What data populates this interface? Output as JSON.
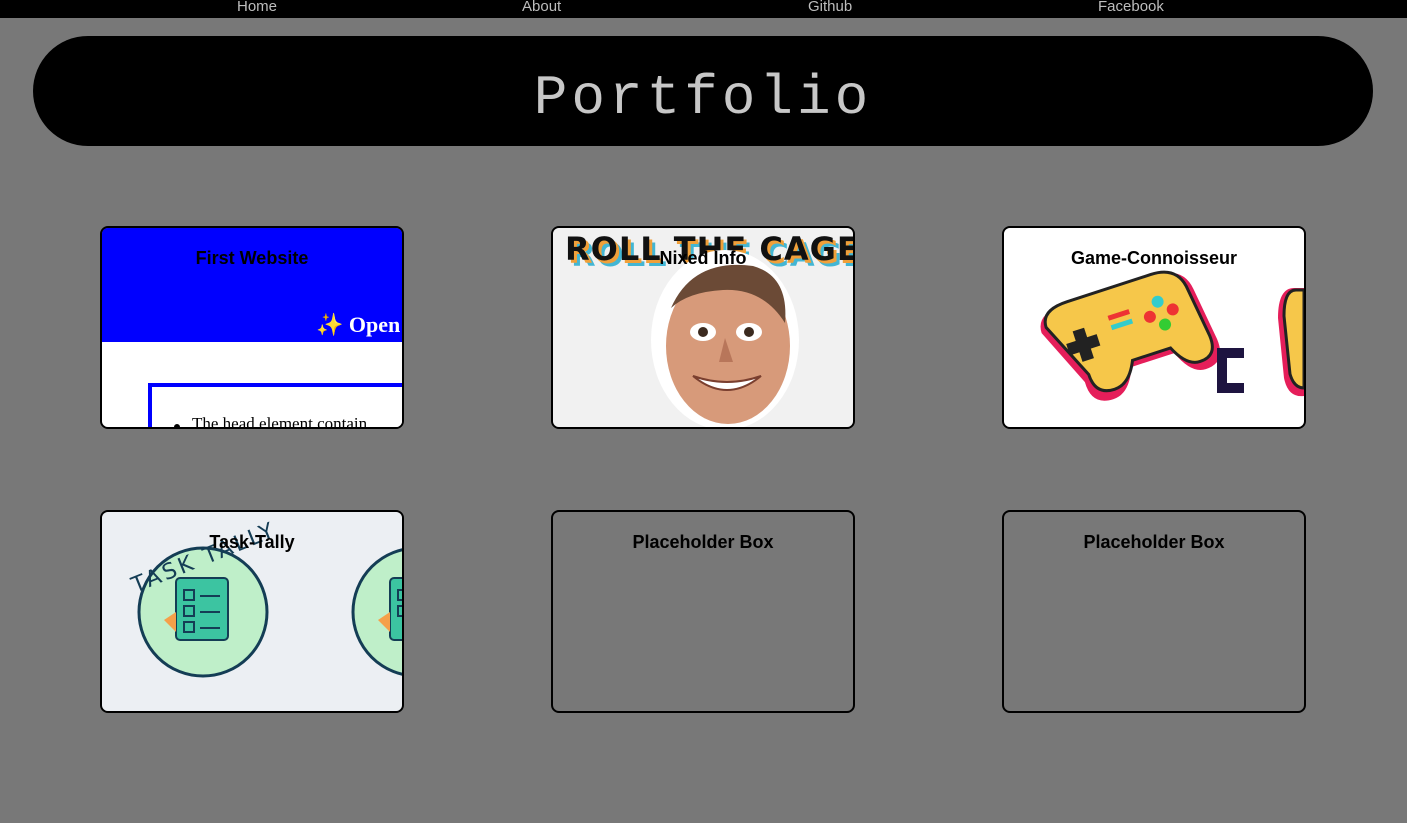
{
  "nav": {
    "home": "Home",
    "about": "About",
    "github": "Github",
    "facebook": "Facebook"
  },
  "banner": {
    "title": "Portfolio"
  },
  "cards": [
    {
      "title": "First Website",
      "preview_heading": "✨ Open",
      "preview_text": "The head element contain"
    },
    {
      "title": "Nixed Info",
      "preview_text": "ROLL THE CAGE DI"
    },
    {
      "title": "Game-Connoisseur"
    },
    {
      "title": "Task-Tally",
      "preview_text": "TASK TALLY"
    },
    {
      "title": "Placeholder Box"
    },
    {
      "title": "Placeholder Box"
    }
  ],
  "colors": {
    "page_bg": "#787878",
    "nav_bg": "#000000",
    "banner_bg": "#000000",
    "banner_text": "#c7c7c7",
    "first_website_blue": "#0000ff"
  }
}
